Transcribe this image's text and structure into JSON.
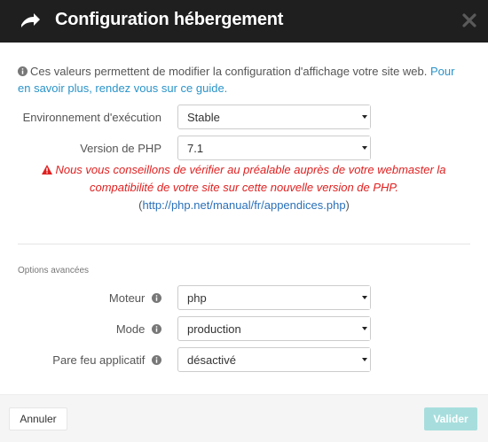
{
  "header": {
    "title": "Configuration hébergement",
    "logo_icon": "paper-plane-icon",
    "close_icon": "close-icon"
  },
  "info": {
    "text": "Ces valeurs permettent de modifier la configuration d'affichage votre site web.",
    "link": "Pour en savoir plus, rendez vous sur ce guide."
  },
  "fields": {
    "environment": {
      "label": "Environnement d'exécution",
      "value": "Stable"
    },
    "php_version": {
      "label": "Version de PHP",
      "value": "7.1"
    }
  },
  "warning": {
    "text": "Nous vous conseillons de vérifier au préalable auprès de votre webmaster la compatibilité de votre site sur cette nouvelle version de PHP.",
    "paren_open": "(",
    "link": "http://php.net/manual/fr/appendices.php",
    "paren_close": ")"
  },
  "advanced": {
    "title": "Options avancées",
    "engine": {
      "label": "Moteur",
      "value": "php"
    },
    "mode": {
      "label": "Mode",
      "value": "production"
    },
    "firewall": {
      "label": "Pare feu applicatif",
      "value": "désactivé"
    }
  },
  "footer": {
    "cancel_label": "Annuler",
    "submit_label": "Valider"
  },
  "colors": {
    "header_bg": "#1f1f1f",
    "link": "#2a93c9",
    "warning": "#e02020",
    "submit_disabled": "#a7dedd"
  }
}
